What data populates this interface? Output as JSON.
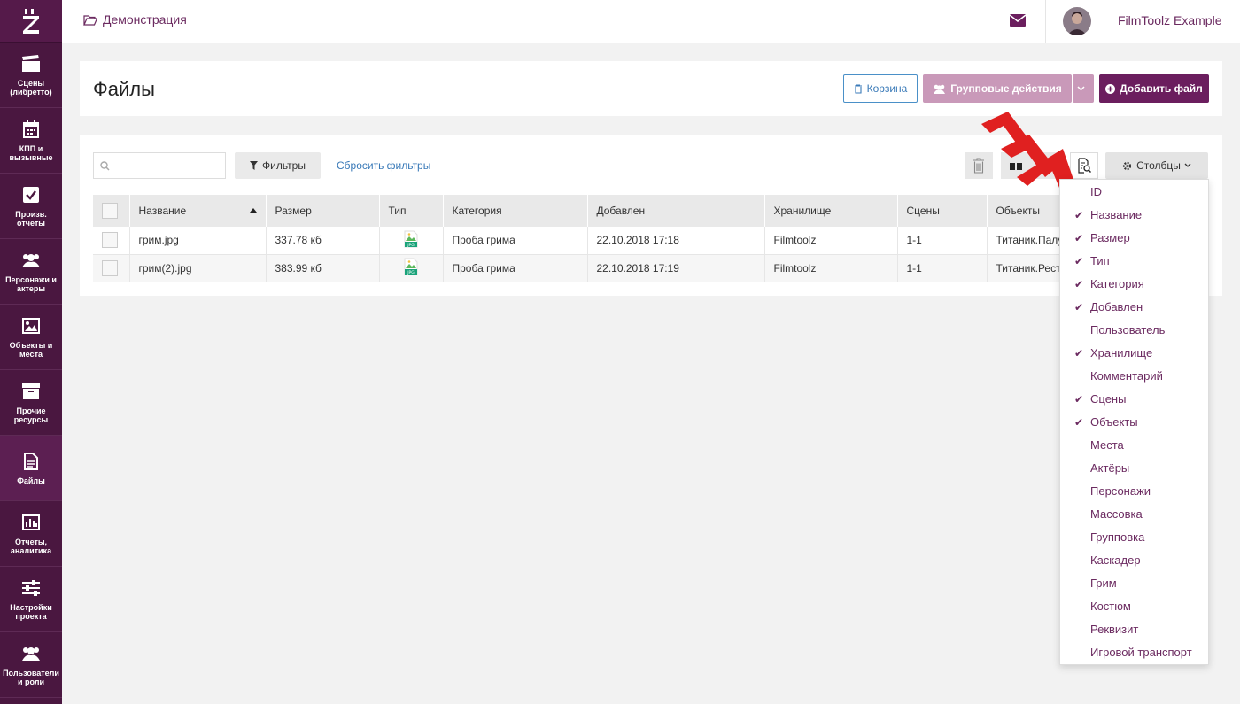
{
  "app": {
    "logo_letter": "Z"
  },
  "sidebar": {
    "items": [
      {
        "label": "Сцены (либретто)",
        "icon": "clapper-icon"
      },
      {
        "label": "КПП и вызывные",
        "icon": "calendar-icon"
      },
      {
        "label": "Произв. отчеты",
        "icon": "checkbox-icon"
      },
      {
        "label": "Персонажи и актеры",
        "icon": "users-icon"
      },
      {
        "label": "Объекты и места",
        "icon": "image-icon"
      },
      {
        "label": "Прочие ресурсы",
        "icon": "archive-icon"
      },
      {
        "label": "Файлы",
        "icon": "file-icon"
      },
      {
        "label": "Отчеты, аналитика",
        "icon": "chart-icon"
      },
      {
        "label": "Настройки проекта",
        "icon": "sliders-icon"
      },
      {
        "label": "Пользователи и роли",
        "icon": "users-icon"
      }
    ],
    "active_index": 6
  },
  "header": {
    "breadcrumb": "Демонстрация",
    "username": "FilmToolz Example"
  },
  "page": {
    "title": "Файлы",
    "trash_label": "Корзина",
    "group_actions_label": "Групповые действия",
    "add_file_label": "Добавить файл"
  },
  "toolbar": {
    "search_placeholder": "",
    "filters_label": "Фильтры",
    "reset_filters_label": "Сбросить фильтры",
    "columns_label": "Столбцы"
  },
  "table": {
    "columns": [
      "Название",
      "Размер",
      "Тип",
      "Категория",
      "Добавлен",
      "Хранилище",
      "Сцены",
      "Объекты"
    ],
    "sort_column": "Название",
    "rows": [
      {
        "name": "грим.jpg",
        "size": "337.78 кб",
        "type": "JPG",
        "category": "Проба грима",
        "added": "22.10.2018 17:18",
        "storage": "Filmtoolz",
        "scenes": "1-1",
        "objects": "Титаник.Палуба"
      },
      {
        "name": "грим(2).jpg",
        "size": "383.99 кб",
        "type": "JPG",
        "category": "Проба грима",
        "added": "22.10.2018 17:19",
        "storage": "Filmtoolz",
        "scenes": "1-1",
        "objects": "Титаник.Ресторан"
      }
    ]
  },
  "columns_menu": {
    "items": [
      {
        "label": "ID",
        "checked": false
      },
      {
        "label": "Название",
        "checked": true
      },
      {
        "label": "Размер",
        "checked": true
      },
      {
        "label": "Тип",
        "checked": true
      },
      {
        "label": "Категория",
        "checked": true
      },
      {
        "label": "Добавлен",
        "checked": true
      },
      {
        "label": "Пользователь",
        "checked": false
      },
      {
        "label": "Хранилище",
        "checked": true
      },
      {
        "label": "Комментарий",
        "checked": false
      },
      {
        "label": "Сцены",
        "checked": true
      },
      {
        "label": "Объекты",
        "checked": true
      },
      {
        "label": "Места",
        "checked": false
      },
      {
        "label": "Актёры",
        "checked": false
      },
      {
        "label": "Персонажи",
        "checked": false
      },
      {
        "label": "Массовка",
        "checked": false
      },
      {
        "label": "Групповка",
        "checked": false
      },
      {
        "label": "Каскадер",
        "checked": false
      },
      {
        "label": "Грим",
        "checked": false
      },
      {
        "label": "Костюм",
        "checked": false
      },
      {
        "label": "Реквизит",
        "checked": false
      },
      {
        "label": "Игровой транспорт",
        "checked": false
      }
    ]
  },
  "colors": {
    "brand": "#6b1e5e",
    "sidebar": "#4a1740",
    "accent_arrow": "#e02020",
    "link": "#3a7ab8"
  }
}
